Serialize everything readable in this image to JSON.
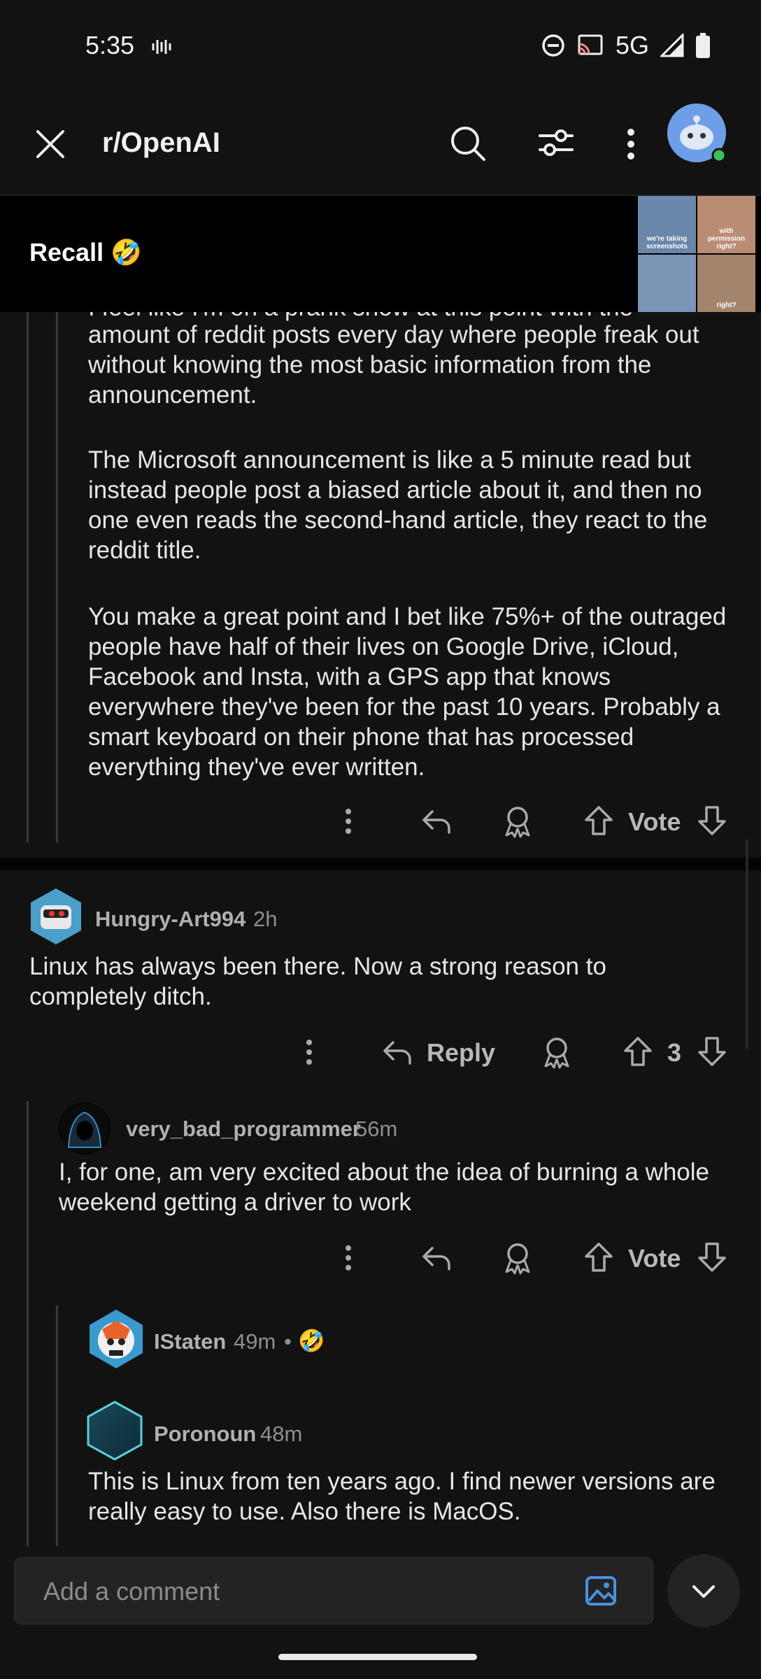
{
  "status_bar": {
    "time": "5:35",
    "network": "5G",
    "icons": [
      "vibrate-icon",
      "dnd-icon",
      "cast-icon",
      "signal-icon",
      "battery-icon"
    ]
  },
  "header": {
    "subreddit": "r/OpenAI",
    "icons": [
      "close-icon",
      "search-icon",
      "filter-icon",
      "more-icon",
      "avatar"
    ]
  },
  "banner": {
    "title": "Recall 🤣",
    "thumb_caption_1": "we're taking screenshots",
    "thumb_caption_2": "with permission right?",
    "thumb_caption_3": "right?"
  },
  "comment_0": {
    "partial_line": "I feel like I'm on a prank show at this point with the",
    "paragraphs": [
      "amount of reddit posts every day where people freak out without knowing the most basic information from the announcement.",
      "The Microsoft announcement is like a 5 minute read but instead people post a biased article about it, and then no one even reads the second-hand article, they react to the reddit title.",
      "You make a great point and I bet like 75%+ of the outraged people have half of their lives on Google Drive, iCloud, Facebook and Insta, with a GPS app that knows everywhere they've been for the past 10 years. Probably a smart keyboard on their phone that has processed everything they've ever written."
    ],
    "vote_label": "Vote"
  },
  "comment_1": {
    "user": "Hungry-Art994",
    "time": "2h",
    "body": "Linux has always been there. Now a strong reason to completely ditch.",
    "reply_label": "Reply",
    "score": "3"
  },
  "comment_2": {
    "user": "very_bad_programmer",
    "time": "56m",
    "body": "I, for one, am very excited about the idea of burning a whole weekend getting a driver to work",
    "vote_label": "Vote"
  },
  "comment_3": {
    "user": "IStaten",
    "time": "49m",
    "sep": "•",
    "emoji": "🤣"
  },
  "comment_4": {
    "user": "Poronoun",
    "time": "48m",
    "body": "This is Linux from ten years ago. I find newer versions are really easy to use. Also there is MacOS."
  },
  "composer": {
    "placeholder": "Add a comment"
  },
  "colors": {
    "background": "#121212",
    "accent_blue": "#4a90e2",
    "online_green": "#3cc05a"
  }
}
